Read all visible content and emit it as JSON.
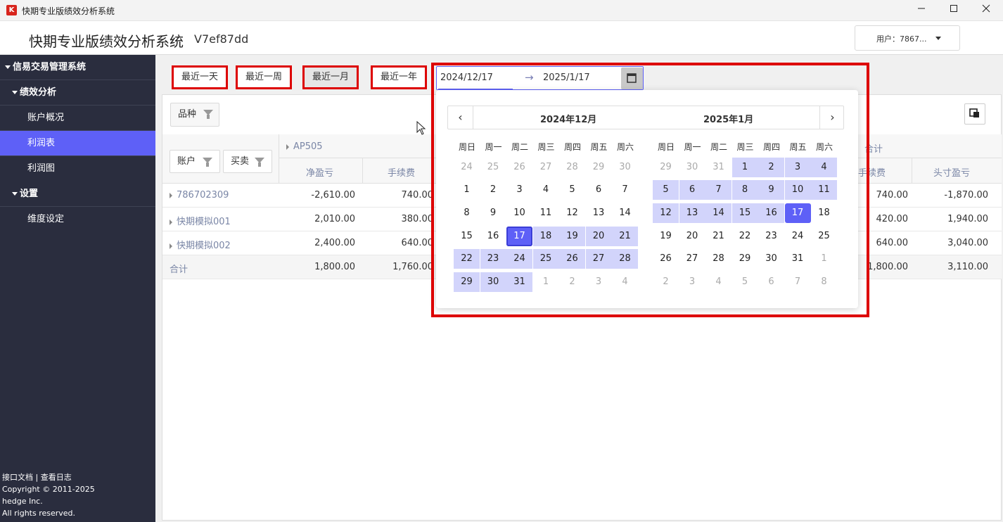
{
  "window": {
    "title": "快期专业版绩效分析系统",
    "logo_text": "K"
  },
  "header": {
    "title": "快期专业版绩效分析系统",
    "version": "V7ef87dd",
    "user_label": "用户：7867..."
  },
  "sidebar": {
    "items": [
      {
        "label": "信易交易管理系统"
      },
      {
        "label": "绩效分析"
      },
      {
        "label": "账户概况"
      },
      {
        "label": "利润表"
      },
      {
        "label": "利润图"
      },
      {
        "label": "设置"
      },
      {
        "label": "维度设定"
      }
    ],
    "footer": {
      "links": "接口文档 | 查看日志",
      "copyright": "Copyright © 2011-2025",
      "company": "hedge Inc.",
      "rights": "All rights reserved."
    }
  },
  "quick_ranges": [
    "最近一天",
    "最近一周",
    "最近一月",
    "最近一年"
  ],
  "range": {
    "start": "2024/12/17",
    "end": "2025/1/17",
    "sep": "→"
  },
  "toolbar": {
    "variety_filter": "品种"
  },
  "table": {
    "account_filter": "账户",
    "side_filter": "买卖",
    "group_ap505": "AP505",
    "group_total": "合计",
    "col_net": "净盈亏",
    "col_fee": "手续费",
    "col_fee_right": "手续费",
    "col_pos": "头寸盈亏",
    "rows": [
      {
        "account": "786702309",
        "net": "-2,610.00",
        "fee": "740.00",
        "fee2": "740.00",
        "pos": "-1,870.00"
      },
      {
        "account": "快期模拟001",
        "net": "2,010.00",
        "fee": "380.00",
        "fee2": "420.00",
        "pos": "1,940.00"
      },
      {
        "account": "快期模拟002",
        "net": "2,400.00",
        "fee": "640.00",
        "fee2": "640.00",
        "pos": "3,040.00"
      }
    ],
    "total": {
      "label": "合计",
      "net": "1,800.00",
      "fee": "1,760.00",
      "fee2": "1,800.00",
      "pos": "3,110.00"
    }
  },
  "calendar": {
    "left_title": "2024年12月",
    "right_title": "2025年1月",
    "weekdays": [
      "周日",
      "周一",
      "周二",
      "周三",
      "周四",
      "周五",
      "周六"
    ],
    "left_days": [
      [
        "24",
        "25",
        "26",
        "27",
        "28",
        "29",
        "30"
      ],
      [
        "1",
        "2",
        "3",
        "4",
        "5",
        "6",
        "7"
      ],
      [
        "8",
        "9",
        "10",
        "11",
        "12",
        "13",
        "14"
      ],
      [
        "15",
        "16",
        "17",
        "18",
        "19",
        "20",
        "21"
      ],
      [
        "22",
        "23",
        "24",
        "25",
        "26",
        "27",
        "28"
      ],
      [
        "29",
        "30",
        "31",
        "1",
        "2",
        "3",
        "4"
      ]
    ],
    "right_days": [
      [
        "29",
        "30",
        "31",
        "1",
        "2",
        "3",
        "4"
      ],
      [
        "5",
        "6",
        "7",
        "8",
        "9",
        "10",
        "11"
      ],
      [
        "12",
        "13",
        "14",
        "15",
        "16",
        "17",
        "18"
      ],
      [
        "19",
        "20",
        "21",
        "22",
        "23",
        "24",
        "25"
      ],
      [
        "26",
        "27",
        "28",
        "29",
        "30",
        "31",
        "1"
      ],
      [
        "2",
        "3",
        "4",
        "5",
        "6",
        "7",
        "8"
      ]
    ],
    "prev_label": "‹",
    "next_label": "›"
  },
  "colors": {
    "accent": "#5e60f7",
    "range_fill": "#d2d4fb",
    "highlight": "#dd0000",
    "sidebar": "#2a2d3e"
  }
}
